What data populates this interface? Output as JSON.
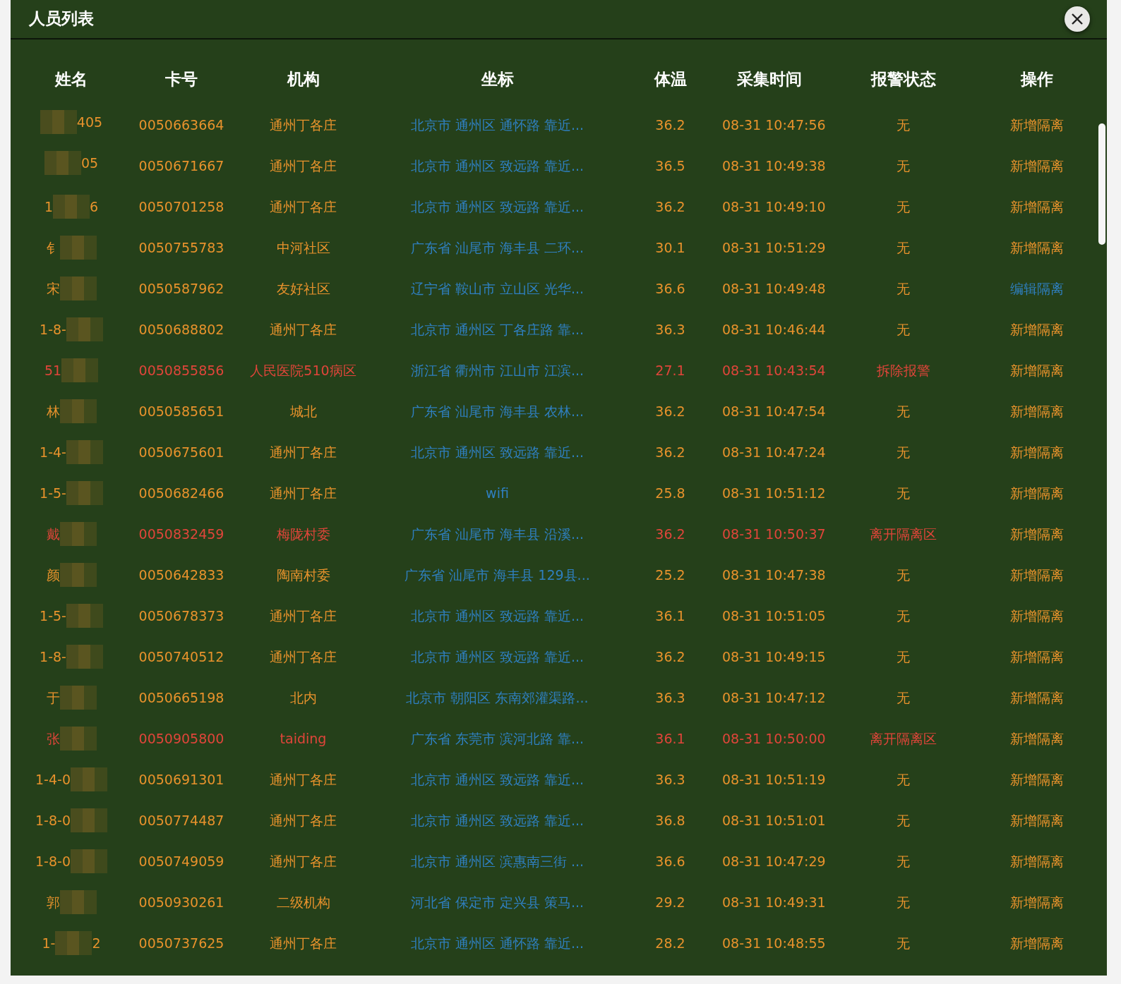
{
  "window": {
    "title": "人员列表"
  },
  "table": {
    "columns": [
      "姓名",
      "卡号",
      "机构",
      "坐标",
      "体温",
      "采集时间",
      "报警状态",
      "操作"
    ],
    "rows": [
      {
        "name_start": "",
        "name_end": "405",
        "card": "0050663664",
        "org": "通州丁各庄",
        "coord": "北京市 通州区 通怀路 靠近...",
        "temp": "36.2",
        "time": "08-31 10:47:56",
        "alarm": "无",
        "alert": false,
        "action": {
          "label": "新增隔离",
          "kind": "new"
        }
      },
      {
        "name_start": "",
        "name_end": "05",
        "card": "0050671667",
        "org": "通州丁各庄",
        "coord": "北京市 通州区 致远路 靠近...",
        "temp": "36.5",
        "time": "08-31 10:49:38",
        "alarm": "无",
        "alert": false,
        "action": {
          "label": "新增隔离",
          "kind": "new"
        }
      },
      {
        "name_start": "1",
        "name_end": "6",
        "card": "0050701258",
        "org": "通州丁各庄",
        "coord": "北京市 通州区 致远路 靠近...",
        "temp": "36.2",
        "time": "08-31 10:49:10",
        "alarm": "无",
        "alert": false,
        "action": {
          "label": "新增隔离",
          "kind": "new"
        }
      },
      {
        "name_start": "钅",
        "name_end": "",
        "card": "0050755783",
        "org": "中河社区",
        "coord": "广东省 汕尾市 海丰县 二环...",
        "temp": "30.1",
        "time": "08-31 10:51:29",
        "alarm": "无",
        "alert": false,
        "action": {
          "label": "新增隔离",
          "kind": "new"
        }
      },
      {
        "name_start": "宋",
        "name_end": "",
        "card": "0050587962",
        "org": "友好社区",
        "coord": "辽宁省 鞍山市 立山区 光华...",
        "temp": "36.6",
        "time": "08-31 10:49:48",
        "alarm": "无",
        "alert": false,
        "action": {
          "label": "编辑隔离",
          "kind": "edit"
        }
      },
      {
        "name_start": "1-8-",
        "name_end": "",
        "card": "0050688802",
        "org": "通州丁各庄",
        "coord": "北京市 通州区 丁各庄路 靠...",
        "temp": "36.3",
        "time": "08-31 10:46:44",
        "alarm": "无",
        "alert": false,
        "action": {
          "label": "新增隔离",
          "kind": "new"
        }
      },
      {
        "name_start": "51",
        "name_end": "",
        "card": "0050855856",
        "org": "人民医院510病区",
        "coord": "浙江省 衢州市 江山市 江滨...",
        "temp": "27.1",
        "time": "08-31 10:43:54",
        "alarm": "拆除报警",
        "alert": true,
        "action": {
          "label": "新增隔离",
          "kind": "new"
        }
      },
      {
        "name_start": "林",
        "name_end": "",
        "card": "0050585651",
        "org": "城北",
        "coord": "广东省 汕尾市 海丰县 农林...",
        "temp": "36.2",
        "time": "08-31 10:47:54",
        "alarm": "无",
        "alert": false,
        "action": {
          "label": "新增隔离",
          "kind": "new"
        }
      },
      {
        "name_start": "1-4-",
        "name_end": "",
        "card": "0050675601",
        "org": "通州丁各庄",
        "coord": "北京市 通州区 致远路 靠近...",
        "temp": "36.2",
        "time": "08-31 10:47:24",
        "alarm": "无",
        "alert": false,
        "action": {
          "label": "新增隔离",
          "kind": "new"
        }
      },
      {
        "name_start": "1-5-",
        "name_end": "",
        "card": "0050682466",
        "org": "通州丁各庄",
        "coord": "wifi",
        "temp": "25.8",
        "time": "08-31 10:51:12",
        "alarm": "无",
        "alert": false,
        "action": {
          "label": "新增隔离",
          "kind": "new"
        }
      },
      {
        "name_start": "戴",
        "name_end": "",
        "card": "0050832459",
        "org": "梅陇村委",
        "coord": "广东省 汕尾市 海丰县 沿溪...",
        "temp": "36.2",
        "time": "08-31 10:50:37",
        "alarm": "离开隔离区",
        "alert": true,
        "action": {
          "label": "新增隔离",
          "kind": "new"
        }
      },
      {
        "name_start": "颜",
        "name_end": "",
        "card": "0050642833",
        "org": "陶南村委",
        "coord": "广东省 汕尾市 海丰县 129县...",
        "temp": "25.2",
        "time": "08-31 10:47:38",
        "alarm": "无",
        "alert": false,
        "action": {
          "label": "新增隔离",
          "kind": "new"
        }
      },
      {
        "name_start": "1-5-",
        "name_end": "",
        "card": "0050678373",
        "org": "通州丁各庄",
        "coord": "北京市 通州区 致远路 靠近...",
        "temp": "36.1",
        "time": "08-31 10:51:05",
        "alarm": "无",
        "alert": false,
        "action": {
          "label": "新增隔离",
          "kind": "new"
        }
      },
      {
        "name_start": "1-8-",
        "name_end": "",
        "card": "0050740512",
        "org": "通州丁各庄",
        "coord": "北京市 通州区 致远路 靠近...",
        "temp": "36.2",
        "time": "08-31 10:49:15",
        "alarm": "无",
        "alert": false,
        "action": {
          "label": "新增隔离",
          "kind": "new"
        }
      },
      {
        "name_start": "于",
        "name_end": "",
        "card": "0050665198",
        "org": "北内",
        "coord": "北京市 朝阳区 东南郊灌渠路...",
        "temp": "36.3",
        "time": "08-31 10:47:12",
        "alarm": "无",
        "alert": false,
        "action": {
          "label": "新增隔离",
          "kind": "new"
        }
      },
      {
        "name_start": "张",
        "name_end": "",
        "card": "0050905800",
        "org": "taiding",
        "coord": "广东省 东莞市 滨河北路 靠...",
        "temp": "36.1",
        "time": "08-31 10:50:00",
        "alarm": "离开隔离区",
        "alert": true,
        "action": {
          "label": "新增隔离",
          "kind": "new"
        }
      },
      {
        "name_start": "1-4-0",
        "name_end": "",
        "card": "0050691301",
        "org": "通州丁各庄",
        "coord": "北京市 通州区 致远路 靠近...",
        "temp": "36.3",
        "time": "08-31 10:51:19",
        "alarm": "无",
        "alert": false,
        "action": {
          "label": "新增隔离",
          "kind": "new"
        }
      },
      {
        "name_start": "1-8-0",
        "name_end": "",
        "card": "0050774487",
        "org": "通州丁各庄",
        "coord": "北京市 通州区 致远路 靠近...",
        "temp": "36.8",
        "time": "08-31 10:51:01",
        "alarm": "无",
        "alert": false,
        "action": {
          "label": "新增隔离",
          "kind": "new"
        }
      },
      {
        "name_start": "1-8-0",
        "name_end": "",
        "card": "0050749059",
        "org": "通州丁各庄",
        "coord": "北京市 通州区 滨惠南三街 ...",
        "temp": "36.6",
        "time": "08-31 10:47:29",
        "alarm": "无",
        "alert": false,
        "action": {
          "label": "新增隔离",
          "kind": "new"
        }
      },
      {
        "name_start": "郭",
        "name_end": "",
        "card": "0050930261",
        "org": "二级机构",
        "coord": "河北省 保定市 定兴县 策马...",
        "temp": "29.2",
        "time": "08-31 10:49:31",
        "alarm": "无",
        "alert": false,
        "action": {
          "label": "新增隔离",
          "kind": "new"
        }
      },
      {
        "name_start": "1-",
        "name_end": "2",
        "card": "0050737625",
        "org": "通州丁各庄",
        "coord": "北京市 通州区 通怀路 靠近...",
        "temp": "28.2",
        "time": "08-31 10:48:55",
        "alarm": "无",
        "alert": false,
        "action": {
          "label": "新增隔离",
          "kind": "new"
        }
      }
    ]
  }
}
